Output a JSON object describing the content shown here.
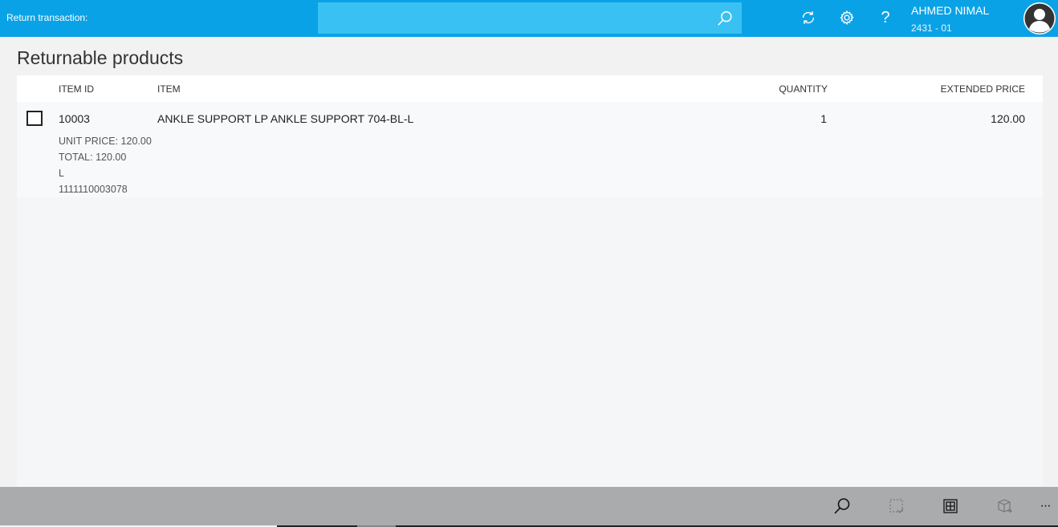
{
  "header": {
    "title": "Return transaction:",
    "search_value": "",
    "search_icon": "search-icon",
    "icons": [
      "refresh-icon",
      "gear-icon",
      "help-icon"
    ],
    "help_glyph": "?",
    "user_name": "AHMED NIMAL",
    "store": "2431 - 01"
  },
  "main": {
    "title": "Returnable products",
    "columns": {
      "item_id": "ITEM ID",
      "item": "ITEM",
      "quantity": "QUANTITY",
      "extended_price": "EXTENDED PRICE"
    },
    "rows": [
      {
        "item_id": "10003",
        "item": "ANKLE SUPPORT LP ANKLE SUPPORT 704-BL-L",
        "quantity": "1",
        "extended_price": "120.00",
        "unit_price": "UNIT PRICE: 120.00",
        "total": "TOTAL: 120.00",
        "variant": "L",
        "barcode": "1111110003078",
        "checked": false
      }
    ]
  },
  "footer": {
    "icons": [
      "search-icon",
      "select-icon",
      "grid-icon",
      "return-product-icon",
      "more-icon"
    ],
    "more_glyph": "···"
  },
  "colors": {
    "header_bg": "#0aa2e6",
    "search_bg": "#39c1f4",
    "footer_bg": "#a9abad"
  }
}
